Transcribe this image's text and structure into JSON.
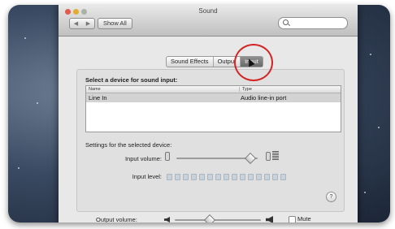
{
  "window": {
    "title": "Sound"
  },
  "toolbar": {
    "back": "◀",
    "forward": "▶",
    "show_all": "Show All",
    "search_placeholder": ""
  },
  "tabs": [
    "Sound Effects",
    "Output",
    "Input"
  ],
  "active_tab": "Input",
  "input": {
    "select_label": "Select a device for sound input:",
    "columns": [
      "Name",
      "Type"
    ],
    "rows": [
      {
        "name": "Line In",
        "type": "Audio line-in port"
      }
    ],
    "settings_label": "Settings for the selected device:",
    "input_volume_label": "Input volume:",
    "input_volume_level": 0.9,
    "input_level_label": "Input level:"
  },
  "help": "?",
  "output": {
    "volume_label": "Output volume:",
    "volume_level": 0.4,
    "mute_label": "Mute"
  },
  "colors": {
    "highlight_circle": "#d42525",
    "active_tab": "#7a7a7a"
  }
}
